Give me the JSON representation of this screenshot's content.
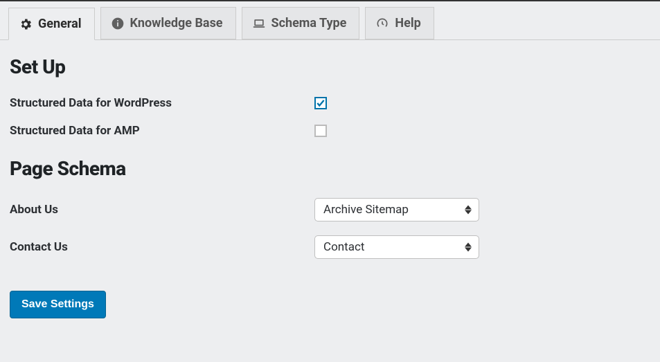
{
  "tabs": {
    "general": "General",
    "knowledge_base": "Knowledge Base",
    "schema_type": "Schema Type",
    "help": "Help"
  },
  "sections": {
    "setup_heading": "Set Up",
    "page_schema_heading": "Page Schema"
  },
  "fields": {
    "structured_wp": {
      "label": "Structured Data for WordPress",
      "checked": true
    },
    "structured_amp": {
      "label": "Structured Data for AMP",
      "checked": false
    },
    "about_us": {
      "label": "About Us",
      "selected": "Archive Sitemap"
    },
    "contact_us": {
      "label": "Contact Us",
      "selected": "Contact"
    }
  },
  "buttons": {
    "save": "Save Settings"
  }
}
